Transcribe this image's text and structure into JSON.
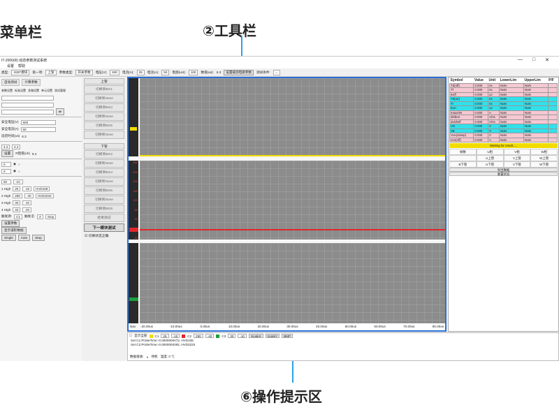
{
  "callouts": {
    "menu": "菜单栏",
    "tool": "②工具栏",
    "hint": "⑥操作提示区"
  },
  "window": {
    "title": "IT-2000(R) 动态参数测试系统",
    "menu": [
      "设置",
      "帮助"
    ],
    "controls": [
      "—",
      "□",
      "✕"
    ]
  },
  "toolbar": {
    "items": [
      {
        "label": "类型:",
        "value": "IGBT模块"
      },
      {
        "label": "第一项:",
        "value": "上管"
      },
      {
        "label": "参数类型:",
        "value": "开关参数"
      },
      {
        "label": "电压(V):",
        "value": "600"
      },
      {
        "label": "电流(A):",
        "value": "25"
      },
      {
        "label": "电流(A):",
        "value": "50"
      },
      {
        "label": "电感(uH):",
        "value": "100"
      },
      {
        "label": "数值(us):",
        "value": "6.3"
      }
    ],
    "button_setup": "设置被测电路参数",
    "test_label": "测试条件:"
  },
  "left": {
    "tabs": [
      "自动测试",
      "计算参数"
    ],
    "tabs2": [
      "参数设置",
      "标准设置",
      "多路设置",
      "单元设置",
      "测试管理"
    ],
    "safety_v_label": "安全电压(V)",
    "safety_v": "600",
    "safety_i_label": "安全电流(A)",
    "safety_i": "50",
    "delay_label": "延迟时间(us)",
    "delay": "6.3",
    "vals": [
      "4.2",
      "4.2"
    ],
    "r_label": "R阻值(uh)",
    "r_val": "9.4",
    "pulses": [
      "1 High",
      "2 High",
      "3 High",
      "4 High"
    ],
    "pulse_vals": [
      "25",
      "280",
      "30",
      "40"
    ],
    "low_vals": [
      "-15",
      "-40",
      "-10",
      "-20"
    ],
    "hvd": [
      "HVD108",
      "HVD3220"
    ],
    "set_btn": "设置参数",
    "show_btn": "显示波形数据",
    "mode_btns": [
      "Single",
      "Auto",
      "Stop"
    ],
    "trigger_label": "触发源:",
    "trigger": "C1",
    "slope_label": "触发沿:",
    "slope": "Z",
    "stop": "Stop"
  },
  "channels": {
    "upper_title": "上管",
    "upper": [
      "切换到BG1",
      "切换到None",
      "切换到BG3",
      "切换到None",
      "切换到BG5",
      "切换到None"
    ],
    "lower_title": "下管",
    "lower": [
      "切换到BG2",
      "切换到None",
      "切换到BG4",
      "切换到None",
      "切换到BG6",
      "切换到None",
      "切换到BG8"
    ],
    "end_btn": "结束测试",
    "next_btn": "下一模块测试",
    "switch_check": "切换状态正确"
  },
  "scope": {
    "ticks_p2": [
      "280",
      "240",
      "200",
      "160",
      "120",
      "80",
      "40",
      "0",
      "-40"
    ],
    "xticks": [
      "-20.00us",
      "-10.00us",
      "0.00us",
      "10.00us",
      "20.00us",
      "30.00us",
      "40.00us",
      "50.00us",
      "60.00us",
      "70.00us",
      "80.00us"
    ],
    "xaxis_prefix": "Nav"
  },
  "results": {
    "headers": [
      "Symbol",
      "Value",
      "Unit",
      "LowerLim",
      "UpperLim",
      "P/F"
    ],
    "rows": [
      [
        "Td(off)",
        "0.000",
        "ns",
        "NaN",
        "NaN",
        ""
      ],
      [
        "Tf",
        "0.000",
        "ns",
        "NaN",
        "NaN",
        ""
      ],
      [
        "Eoff",
        "0.000",
        "uJ",
        "NaN",
        "NaN",
        ""
      ],
      [
        "Td(on)",
        "0.000",
        "ns",
        "NaN",
        "NaN",
        ""
      ],
      [
        "Tr",
        "0.000",
        "ns",
        "NaN",
        "NaN",
        ""
      ],
      [
        "Eon",
        "0.000",
        "uJ",
        "NaN",
        "NaN",
        ""
      ],
      [
        "ImaxON",
        "0.000",
        "A",
        "NaN",
        "NaN",
        ""
      ],
      [
        "di/dton",
        "0.000",
        "A/ns",
        "NaN",
        "NaN",
        ""
      ],
      [
        "du/dtoff",
        "0.000",
        "V/ns",
        "NaN",
        "NaN",
        ""
      ],
      [
        "VG",
        "0.000",
        "V",
        "NaN",
        "NaN",
        ""
      ],
      [
        "VE",
        "0.000",
        "V",
        "NaN",
        "NaN",
        ""
      ],
      [
        "Vce(clamp)",
        "0.000",
        "V",
        "NaN",
        "NaN",
        ""
      ],
      [
        "Icm(off)",
        "0.000",
        "A",
        "NaN",
        "NaN",
        ""
      ]
    ],
    "row_colors": [
      "pink",
      "pink",
      "pink",
      "cyan",
      "cyan",
      "cyan",
      "pink",
      "pink",
      "pink",
      "cyan",
      "cyan",
      "pink",
      "pink"
    ],
    "waiting": "Waiting for result.....",
    "grid": [
      "帧数",
      "U相",
      "V相",
      "W相",
      "",
      "U上管",
      "V上管",
      "W上管",
      "B下管",
      "U下管",
      "V下管",
      "W下管"
    ],
    "export_btn": "导出数据",
    "reset_btn": "重置状态"
  },
  "bottom": {
    "show_all": "显示全部",
    "channels": [
      {
        "name": "C1",
        "color": "#f2dc00",
        "low": "25",
        "high": "-15"
      },
      {
        "name": "C2",
        "color": "#e0262b",
        "low": "280",
        "high": "-40"
      },
      {
        "name": "C3",
        "color": "#1f9e3a",
        "low": "30",
        "high": "-10"
      }
    ],
    "scale_x": "ScaleX",
    "scale_y": "ScaleY",
    "bmp": "BMP",
    "hints": [
      "Set C1:ProbeTime:-0.0000000472, HVD108",
      "Set C2:ProbeTime:-0.0000000392, HVD3220"
    ],
    "status_label": "数据接收:",
    "status_val": "待机",
    "status_right": "温度: 0 ℃"
  }
}
